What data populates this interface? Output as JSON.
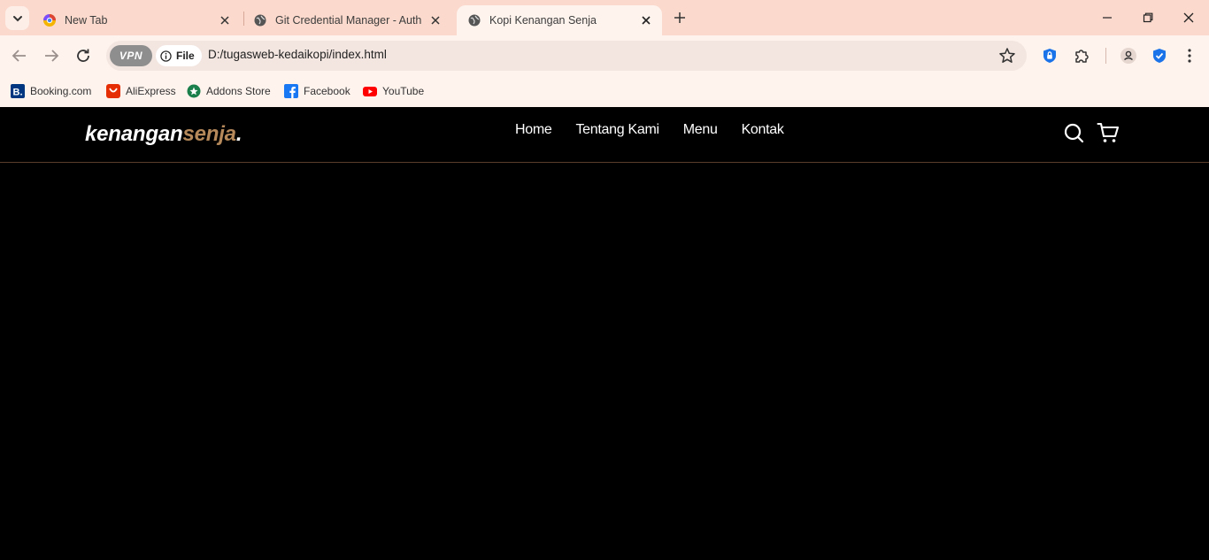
{
  "browser": {
    "tabs": [
      {
        "title": "New Tab",
        "active": false,
        "icon": "browser-logo-icon"
      },
      {
        "title": "Git Credential Manager - Authe",
        "active": false,
        "icon": "globe-icon"
      },
      {
        "title": "Kopi Kenangan Senja",
        "active": true,
        "icon": "globe-icon"
      }
    ],
    "vpn_label": "VPN",
    "site_chip_label": "File",
    "url": "D:/tugasweb-kedaikopi/index.html",
    "bookmarks": [
      {
        "label": "Booking.com",
        "icon": "booking-icon",
        "color": "#003580"
      },
      {
        "label": "AliExpress",
        "icon": "aliexpress-icon",
        "color": "#e62e04"
      },
      {
        "label": "Addons Store",
        "icon": "addons-store-icon",
        "color": "#1a7f4b"
      },
      {
        "label": "Facebook",
        "icon": "facebook-icon",
        "color": "#1877f2"
      },
      {
        "label": "YouTube",
        "icon": "youtube-icon",
        "color": "#ff0000"
      }
    ]
  },
  "site": {
    "logo_main": "kenangan",
    "logo_accent": "senja",
    "logo_dot": ".",
    "accent_color": "#b6895b",
    "menu": [
      "Home",
      "Tentang Kami",
      "Menu",
      "Kontak"
    ],
    "icons": [
      "search-icon",
      "shopping-cart-icon"
    ]
  }
}
